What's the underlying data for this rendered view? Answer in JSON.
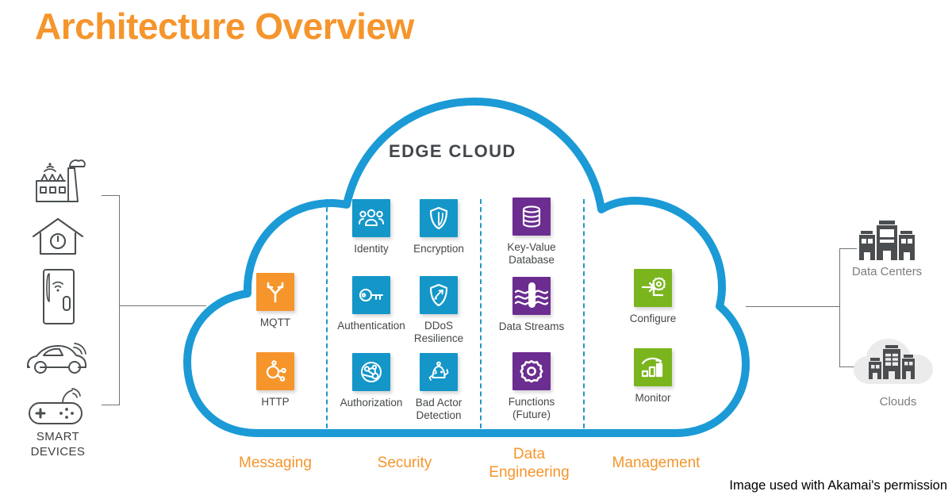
{
  "title": "Architecture Overview",
  "cloud": {
    "heading": "EDGE CLOUD",
    "outline_color": "#1b9ad6"
  },
  "colors": {
    "orange": "#f5952c",
    "blue": "#1496c8",
    "purple": "#6b2d90",
    "green": "#7ab51d",
    "label_gray": "#444749",
    "muted_gray": "#7a7d80",
    "line_gray": "#6f7477",
    "cloud_fill": "#ebebeb"
  },
  "left_panel": {
    "label": "SMART\nDEVICES",
    "devices": [
      {
        "name": "factory-icon",
        "title": "Factory"
      },
      {
        "name": "smart-home-icon",
        "title": "Smart Home"
      },
      {
        "name": "smart-refrigerator-icon",
        "title": "Smart Refrigerator"
      },
      {
        "name": "connected-car-icon",
        "title": "Connected Car"
      },
      {
        "name": "game-controller-icon",
        "title": "Game Controller"
      }
    ]
  },
  "columns": [
    {
      "key": "messaging",
      "label": "Messaging",
      "color": "#f5952c",
      "tiles": [
        {
          "label": "MQTT",
          "icon": "mqtt-branch-icon"
        },
        {
          "label": "HTTP",
          "icon": "http-hub-icon"
        }
      ]
    },
    {
      "key": "security",
      "label": "Security",
      "color": "#1496c8",
      "tiles": [
        {
          "label": "Identity",
          "icon": "people-icon"
        },
        {
          "label": "Encryption",
          "icon": "shield-icon"
        },
        {
          "label": "Authentication",
          "icon": "key-icon"
        },
        {
          "label": "DDoS\nResilience",
          "icon": "shield-arrow-icon"
        },
        {
          "label": "Authorization",
          "icon": "globe-network-icon"
        },
        {
          "label": "Bad Actor\nDetection",
          "icon": "robot-icon"
        }
      ]
    },
    {
      "key": "data_engineering",
      "label": "Data\nEngineering",
      "color": "#6b2d90",
      "tiles": [
        {
          "label": "Key-Value\nDatabase",
          "icon": "database-icon"
        },
        {
          "label": "Data Streams",
          "icon": "data-waves-icon"
        },
        {
          "label": "Functions\n(Future)",
          "icon": "gear-icon"
        }
      ]
    },
    {
      "key": "management",
      "label": "Management",
      "color": "#7ab51d",
      "tiles": [
        {
          "label": "Configure",
          "icon": "configure-gear-icon"
        },
        {
          "label": "Monitor",
          "icon": "bar-chart-arrow-icon"
        }
      ]
    }
  ],
  "right_panel": {
    "endpoints": [
      {
        "label": "Data Centers",
        "icon": "data-center-buildings-icon"
      },
      {
        "label": "Clouds",
        "icon": "cloud-buildings-icon"
      }
    ]
  },
  "credit": "Image used with Akamai's permission"
}
